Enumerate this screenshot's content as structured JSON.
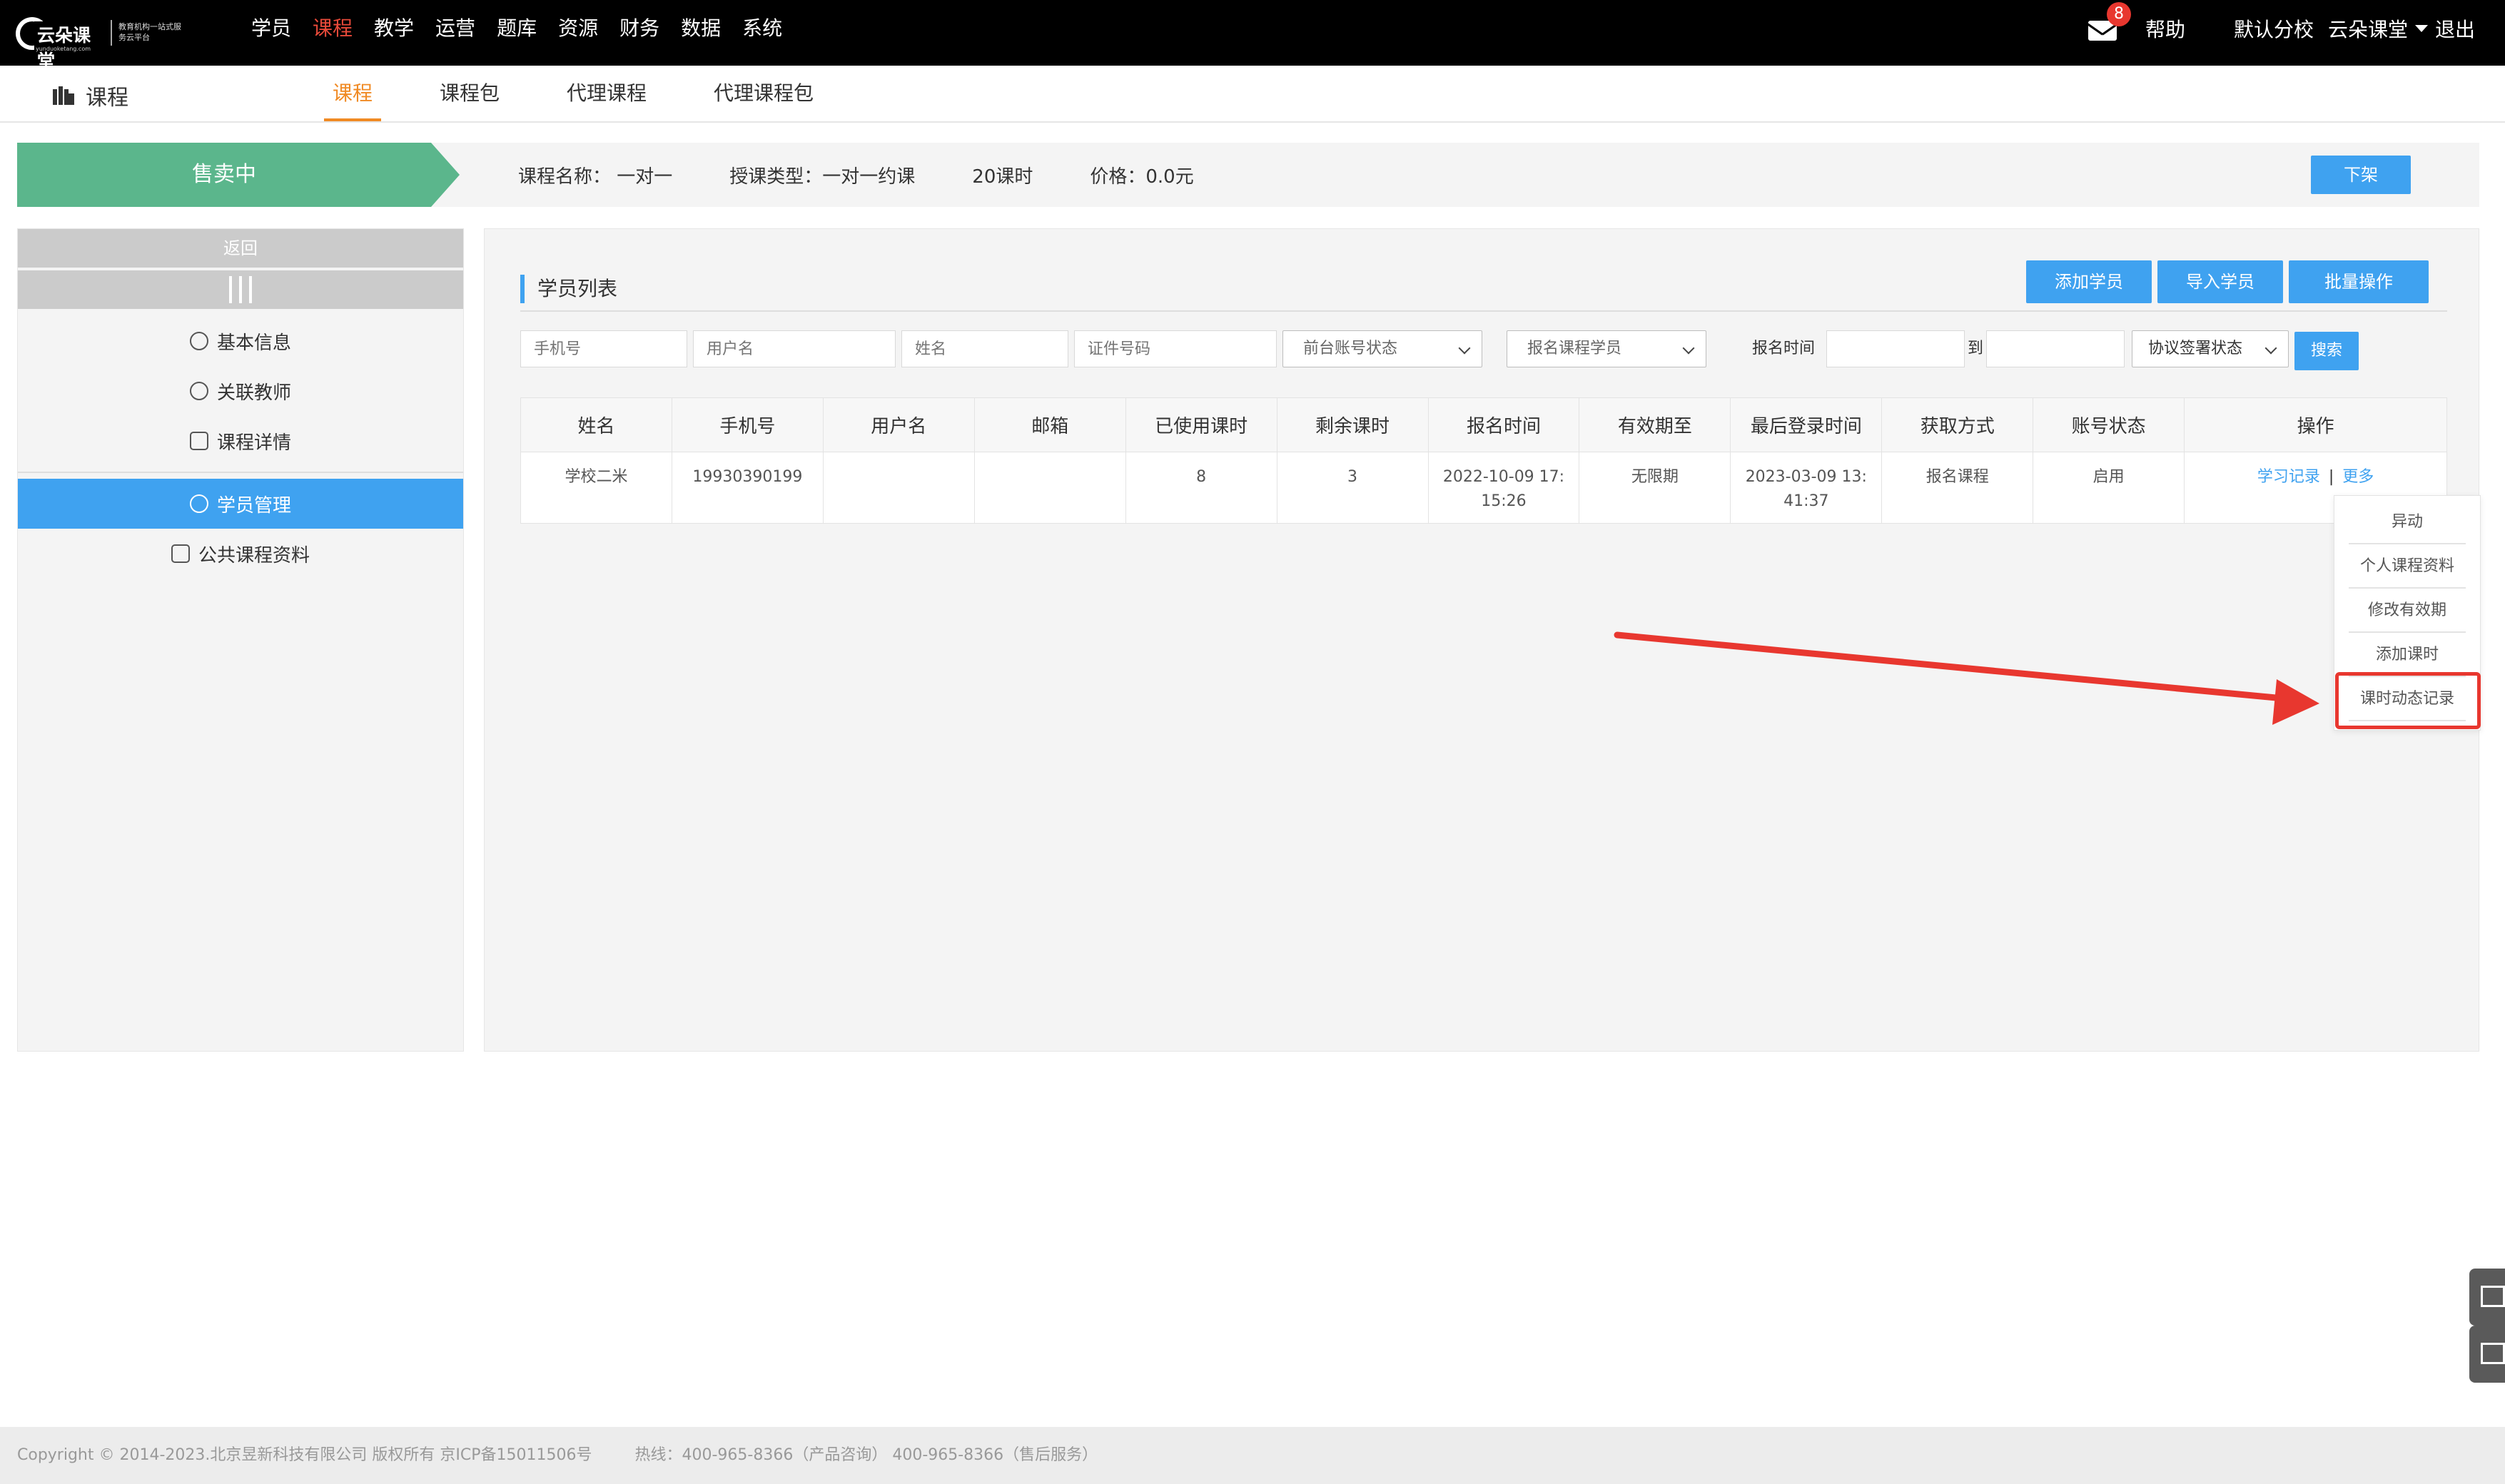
{
  "topbar": {
    "logo_text": "云朵课堂",
    "logo_domain": "yunduoketang.com",
    "logo_slogan": "教育机构一站式服务云平台",
    "nav": [
      "学员",
      "课程",
      "教学",
      "运营",
      "题库",
      "资源",
      "财务",
      "数据",
      "系统"
    ],
    "active_nav": "课程",
    "mail_count": "8",
    "help": "帮助",
    "school": "默认分校",
    "user": "云朵课堂",
    "logout": "退出"
  },
  "subheader": {
    "title": "课程",
    "tabs": [
      "课程",
      "课程包",
      "代理课程",
      "代理课程包"
    ],
    "active_tab": "课程"
  },
  "course_info": {
    "status": "售卖中",
    "name": "课程名称： 一对一",
    "teach_type": "授课类型：一对一约课",
    "hours": "20课时",
    "price": "价格：0.0元",
    "off_button": "下架"
  },
  "sidebar": {
    "back": "返回",
    "items": [
      {
        "label": "基本信息",
        "icon": "list-icon"
      },
      {
        "label": "关联教师",
        "icon": "play-icon"
      },
      {
        "label": "课程详情",
        "icon": "detail-icon"
      },
      {
        "label": "学员管理",
        "icon": "users-icon",
        "active": true
      },
      {
        "label": "公共课程资料",
        "icon": "attachment-icon"
      }
    ]
  },
  "panel": {
    "title": "学员列表",
    "buttons": [
      "添加学员",
      "导入学员",
      "批量操作"
    ],
    "filters": {
      "phone_placeholder": "手机号",
      "username_placeholder": "用户名",
      "name_placeholder": "姓名",
      "id_placeholder": "证件号码",
      "account_status": "前台账号状态",
      "enroll_type": "报名课程学员",
      "enroll_time_label": "报名时间",
      "to_label": "到",
      "agreement": "协议签署状态",
      "search": "搜索"
    },
    "table": {
      "columns": [
        "姓名",
        "手机号",
        "用户名",
        "邮箱",
        "已使用课时",
        "剩余课时",
        "报名时间",
        "有效期至",
        "最后登录时间",
        "获取方式",
        "账号状态",
        "操作"
      ],
      "rows": [
        {
          "name": "学校二米",
          "phone": "19930390199",
          "username": "",
          "email": "",
          "used": "8",
          "remaining": "3",
          "enroll_time": "2022-10-09 17:15:26",
          "valid_until": "无限期",
          "last_login": "2023-03-09 13:41:37",
          "source": "报名课程",
          "status": "启用",
          "op_study": "学习记录",
          "op_sep": "|",
          "op_more": "更多"
        }
      ]
    }
  },
  "dropdown": {
    "items": [
      "异动",
      "个人课程资料",
      "修改有效期",
      "添加课时",
      "课时动态记录"
    ],
    "highlighted": "课时动态记录"
  },
  "annotation_color": "#e8372f",
  "footer": {
    "copyright": "Copyright © 2014-2023.北京昱新科技有限公司 版权所有 京ICP备15011506号",
    "hotline": "热线：400-965-8366（产品咨询） 400-965-8366（售后服务）"
  }
}
